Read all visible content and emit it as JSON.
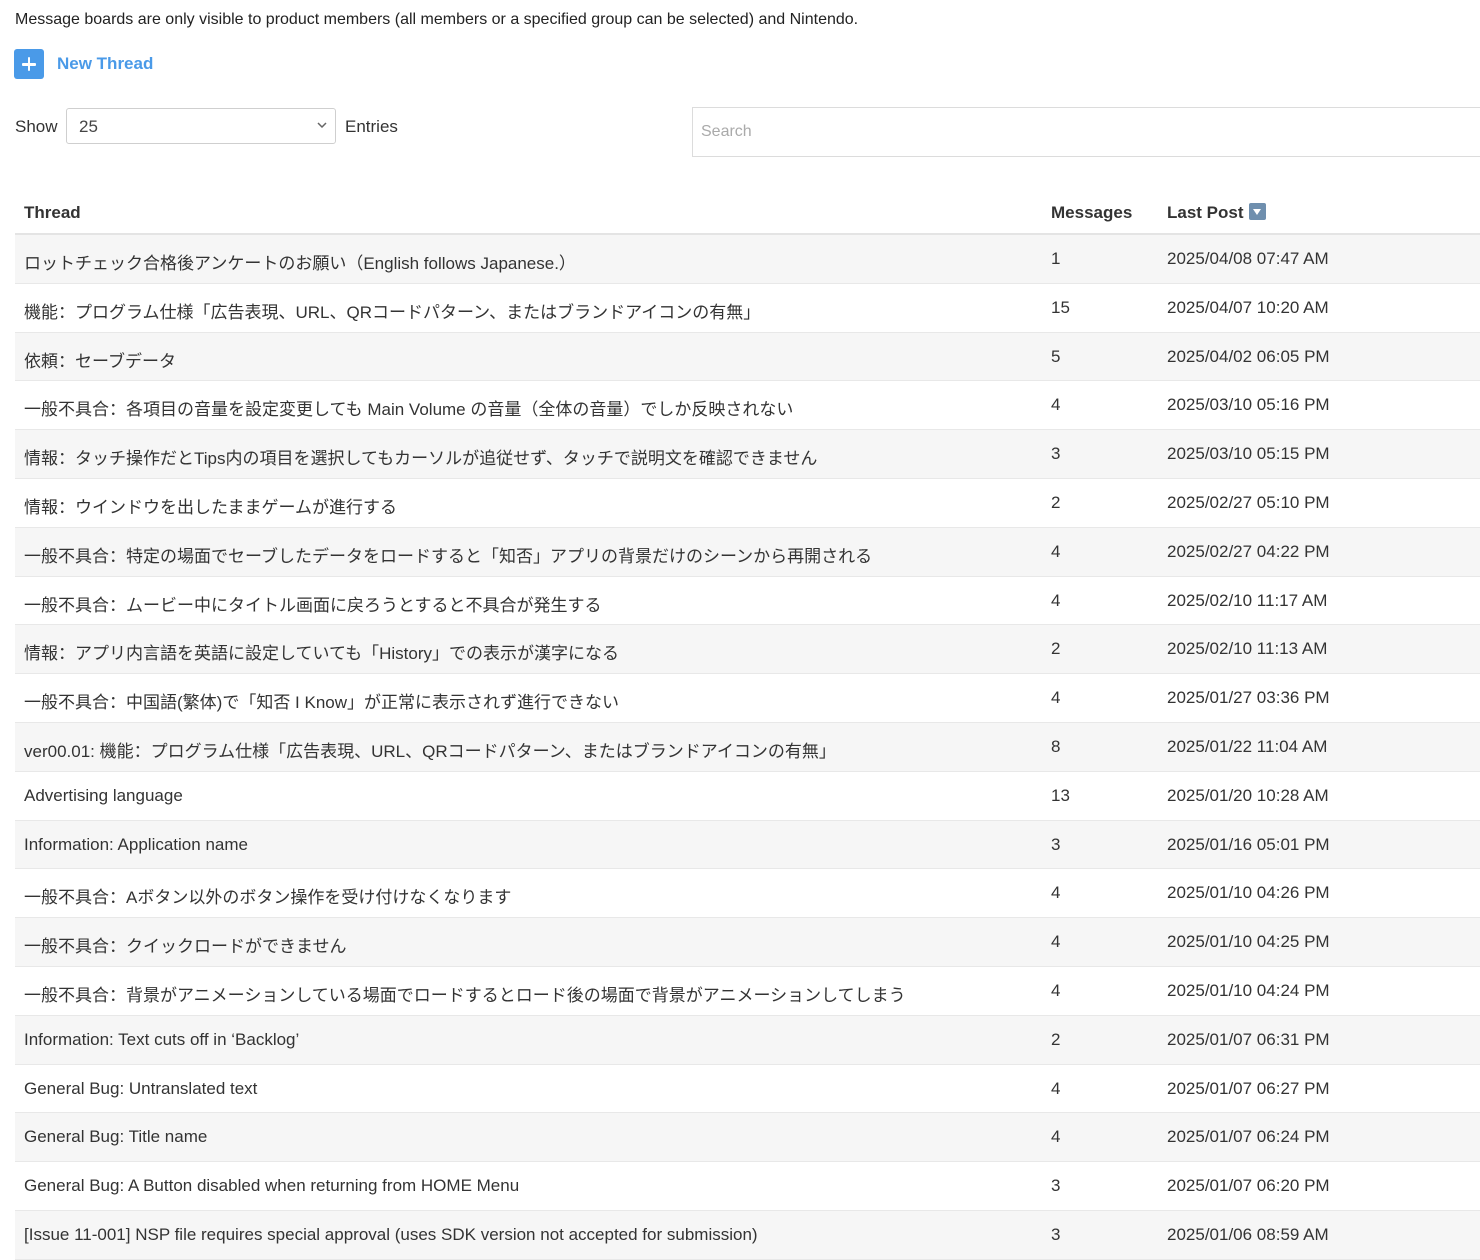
{
  "notice": "Message boards are only visible to product members (all members or a specified group can be selected) and Nintendo.",
  "new_thread": {
    "icon": "plus-icon",
    "label": "New Thread",
    "color": "#4a9ae8"
  },
  "length_control": {
    "show_label": "Show",
    "selected": "25",
    "entries_label": "Entries"
  },
  "search": {
    "placeholder": "Search",
    "value": ""
  },
  "table": {
    "headers": {
      "thread": "Thread",
      "messages": "Messages",
      "last_post": "Last Post"
    },
    "sort": {
      "column": "last_post",
      "direction": "descending",
      "icon": "sort-descending-icon"
    },
    "rows": [
      {
        "thread": "ロットチェック合格後アンケートのお願い（English follows Japanese.）",
        "messages": "1",
        "last_post": "2025/04/08 07:47 AM"
      },
      {
        "thread": "機能：プログラム仕様「広告表現、URL、QRコードパターン、またはブランドアイコンの有無」",
        "messages": "15",
        "last_post": "2025/04/07 10:20 AM"
      },
      {
        "thread": "依頼：セーブデータ",
        "messages": "5",
        "last_post": "2025/04/02 06:05 PM"
      },
      {
        "thread": "一般不具合：各項目の音量を設定変更しても Main Volume の音量（全体の音量）でしか反映されない",
        "messages": "4",
        "last_post": "2025/03/10 05:16 PM"
      },
      {
        "thread": "情報：タッチ操作だとTips内の項目を選択してもカーソルが追従せず、タッチで説明文を確認できません",
        "messages": "3",
        "last_post": "2025/03/10 05:15 PM"
      },
      {
        "thread": "情報：ウインドウを出したままゲームが進行する",
        "messages": "2",
        "last_post": "2025/02/27 05:10 PM"
      },
      {
        "thread": "一般不具合：特定の場面でセーブしたデータをロードすると「知否」アプリの背景だけのシーンから再開される",
        "messages": "4",
        "last_post": "2025/02/27 04:22 PM"
      },
      {
        "thread": "一般不具合：ムービー中にタイトル画面に戻ろうとすると不具合が発生する",
        "messages": "4",
        "last_post": "2025/02/10 11:17 AM"
      },
      {
        "thread": "情報：アプリ内言語を英語に設定していても「History」での表示が漢字になる",
        "messages": "2",
        "last_post": "2025/02/10 11:13 AM"
      },
      {
        "thread": "一般不具合：中国語(繁体)で「知否 I Know」が正常に表示されず進行できない",
        "messages": "4",
        "last_post": "2025/01/27 03:36 PM"
      },
      {
        "thread": "ver00.01: 機能：プログラム仕様「広告表現、URL、QRコードパターン、またはブランドアイコンの有無」",
        "messages": "8",
        "last_post": "2025/01/22 11:04 AM"
      },
      {
        "thread": "Advertising language",
        "messages": "13",
        "last_post": "2025/01/20 10:28 AM"
      },
      {
        "thread": "Information: Application name",
        "messages": "3",
        "last_post": "2025/01/16 05:01 PM"
      },
      {
        "thread": "一般不具合：Aボタン以外のボタン操作を受け付けなくなります",
        "messages": "4",
        "last_post": "2025/01/10 04:26 PM"
      },
      {
        "thread": "一般不具合：クイックロードができません",
        "messages": "4",
        "last_post": "2025/01/10 04:25 PM"
      },
      {
        "thread": "一般不具合：背景がアニメーションしている場面でロードするとロード後の場面で背景がアニメーションしてしまう",
        "messages": "4",
        "last_post": "2025/01/10 04:24 PM"
      },
      {
        "thread": "Information: Text cuts off in ‘Backlog’",
        "messages": "2",
        "last_post": "2025/01/07 06:31 PM"
      },
      {
        "thread": "General Bug: Untranslated text",
        "messages": "4",
        "last_post": "2025/01/07 06:27 PM"
      },
      {
        "thread": "General Bug: Title name",
        "messages": "4",
        "last_post": "2025/01/07 06:24 PM"
      },
      {
        "thread": "General Bug: A Button disabled when returning from HOME Menu",
        "messages": "3",
        "last_post": "2025/01/07 06:20 PM"
      },
      {
        "thread": "[Issue 11-001] NSP file requires special approval (uses SDK version not accepted for submission)",
        "messages": "3",
        "last_post": "2025/01/06 08:59 AM"
      }
    ]
  }
}
